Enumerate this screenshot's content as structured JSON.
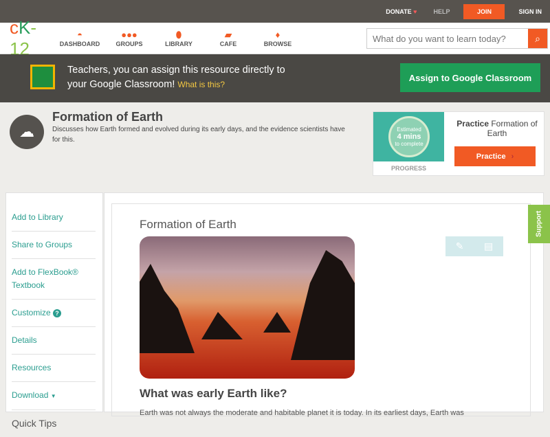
{
  "topbar": {
    "donate": "DONATE",
    "help": "HELP",
    "join": "JOIN",
    "signin": "SIGN IN"
  },
  "logo": {
    "c": "c",
    "k": "K",
    "rest": "-12"
  },
  "nav": [
    {
      "label": "DASHBOARD",
      "icon": "gauge-icon"
    },
    {
      "label": "GROUPS",
      "icon": "groups-icon"
    },
    {
      "label": "LIBRARY",
      "icon": "backpack-icon"
    },
    {
      "label": "CAFE",
      "icon": "chat-icon"
    },
    {
      "label": "BROWSE",
      "icon": "lightbulb-icon"
    }
  ],
  "search": {
    "placeholder": "What do you want to learn today?"
  },
  "classroom": {
    "text1": "Teachers, you can assign this resource directly to",
    "text2": "your Google Classroom!",
    "link": "What is this?",
    "button": "Assign to Google Classroom"
  },
  "lesson": {
    "title": "Formation of Earth",
    "description": "Discusses how Earth formed and evolved during its early days, and the evidence scientists have for this."
  },
  "practice": {
    "est1": "Estimated",
    "est2": "4 mins",
    "est3": "to complete",
    "progress": "PROGRESS",
    "bold": "Practice",
    "title": "Formation of Earth",
    "button": "Practice"
  },
  "sidebar": {
    "items": [
      "Add to Library",
      "Share to Groups",
      "Add to FlexBook® Textbook",
      "Customize",
      "Details",
      "Resources",
      "Download"
    ],
    "quick_tips": "Quick Tips"
  },
  "content": {
    "title": "Formation of Earth",
    "heading": "What was early Earth like?",
    "paragraph": "Earth was not always the moderate and habitable planet it is today. In its earliest days, Earth was"
  },
  "support": "Support"
}
